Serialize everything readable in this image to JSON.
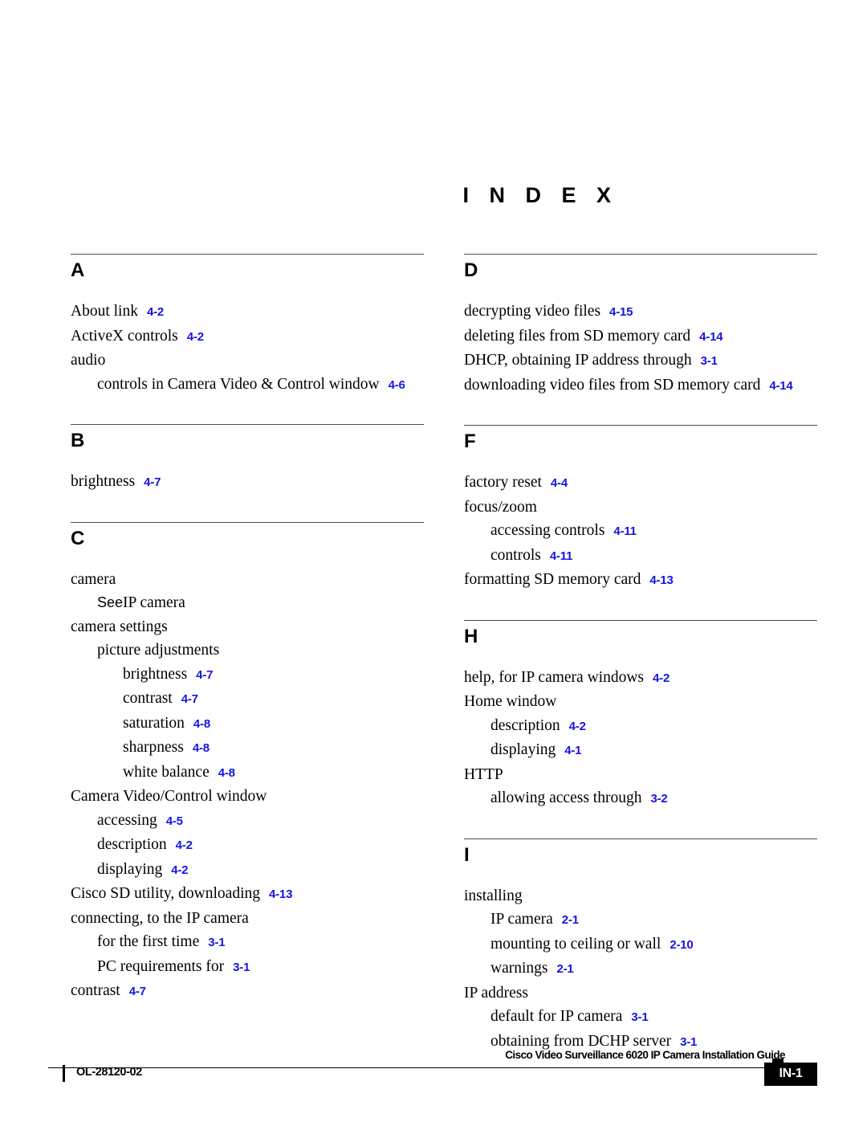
{
  "page": {
    "title": "I N D E X",
    "accent_ref_color": "#1414e6",
    "rule_color": "#4d4d4d"
  },
  "columns": [
    {
      "id": "left",
      "sections": [
        {
          "letter": "A",
          "entries": [
            {
              "level": 0,
              "text": "About link",
              "ref": "4-2"
            },
            {
              "level": 0,
              "text": "ActiveX controls",
              "ref": "4-2"
            },
            {
              "level": 0,
              "text": "audio",
              "ref": ""
            },
            {
              "level": 1,
              "text": "controls in Camera Video & Control window",
              "ref": "4-6"
            }
          ]
        },
        {
          "letter": "B",
          "entries": [
            {
              "level": 0,
              "text": "brightness",
              "ref": "4-7"
            }
          ]
        },
        {
          "letter": "C",
          "entries": [
            {
              "level": 0,
              "text": "camera",
              "ref": ""
            },
            {
              "level": 1,
              "see": "See",
              "text": "IP camera",
              "ref": ""
            },
            {
              "level": 0,
              "text": "camera settings",
              "ref": ""
            },
            {
              "level": 1,
              "text": "picture adjustments",
              "ref": ""
            },
            {
              "level": 2,
              "text": "brightness",
              "ref": "4-7"
            },
            {
              "level": 2,
              "text": "contrast",
              "ref": "4-7"
            },
            {
              "level": 2,
              "text": "saturation",
              "ref": "4-8"
            },
            {
              "level": 2,
              "text": "sharpness",
              "ref": "4-8"
            },
            {
              "level": 2,
              "text": "white balance",
              "ref": "4-8"
            },
            {
              "level": 0,
              "text": "Camera Video/Control window",
              "ref": ""
            },
            {
              "level": 1,
              "text": "accessing",
              "ref": "4-5"
            },
            {
              "level": 1,
              "text": "description",
              "ref": "4-2"
            },
            {
              "level": 1,
              "text": "displaying",
              "ref": "4-2"
            },
            {
              "level": 0,
              "text": "Cisco SD utility, downloading",
              "ref": "4-13"
            },
            {
              "level": 0,
              "text": "connecting, to the IP camera",
              "ref": ""
            },
            {
              "level": 1,
              "text": "for the first time",
              "ref": "3-1"
            },
            {
              "level": 1,
              "text": "PC requirements for",
              "ref": "3-1"
            },
            {
              "level": 0,
              "text": "contrast",
              "ref": "4-7"
            }
          ]
        }
      ]
    },
    {
      "id": "right",
      "sections": [
        {
          "letter": "D",
          "entries": [
            {
              "level": 0,
              "text": "decrypting video files",
              "ref": "4-15"
            },
            {
              "level": 0,
              "text": "deleting files from SD memory card",
              "ref": "4-14"
            },
            {
              "level": 0,
              "text": "DHCP, obtaining IP address through",
              "ref": "3-1"
            },
            {
              "level": 0,
              "text": "downloading video files from SD memory card",
              "ref": "4-14"
            }
          ]
        },
        {
          "letter": "F",
          "entries": [
            {
              "level": 0,
              "text": "factory reset",
              "ref": "4-4"
            },
            {
              "level": 0,
              "text": "focus/zoom",
              "ref": ""
            },
            {
              "level": 1,
              "text": "accessing controls",
              "ref": "4-11"
            },
            {
              "level": 1,
              "text": "controls",
              "ref": "4-11"
            },
            {
              "level": 0,
              "text": "formatting SD memory card",
              "ref": "4-13"
            }
          ]
        },
        {
          "letter": "H",
          "entries": [
            {
              "level": 0,
              "text": "help, for IP camera windows",
              "ref": "4-2"
            },
            {
              "level": 0,
              "text": "Home window",
              "ref": ""
            },
            {
              "level": 1,
              "text": "description",
              "ref": "4-2"
            },
            {
              "level": 1,
              "text": "displaying",
              "ref": "4-1"
            },
            {
              "level": 0,
              "text": "HTTP",
              "ref": ""
            },
            {
              "level": 1,
              "text": "allowing access through",
              "ref": "3-2"
            }
          ]
        },
        {
          "letter": "I",
          "entries": [
            {
              "level": 0,
              "text": "installing",
              "ref": ""
            },
            {
              "level": 1,
              "text": "IP camera",
              "ref": "2-1"
            },
            {
              "level": 1,
              "text": "mounting to ceiling or wall",
              "ref": "2-10"
            },
            {
              "level": 1,
              "text": "warnings",
              "ref": "2-1"
            },
            {
              "level": 0,
              "text": "IP address",
              "ref": ""
            },
            {
              "level": 1,
              "text": "default for IP camera",
              "ref": "3-1"
            },
            {
              "level": 1,
              "text": "obtaining from DCHP server",
              "ref": "3-1"
            }
          ]
        }
      ]
    }
  ],
  "footer": {
    "guide_title": "Cisco Video Surveillance 6020 IP Camera Installation Guide",
    "doc_id": "OL-28120-02",
    "page_number": "IN-1"
  }
}
